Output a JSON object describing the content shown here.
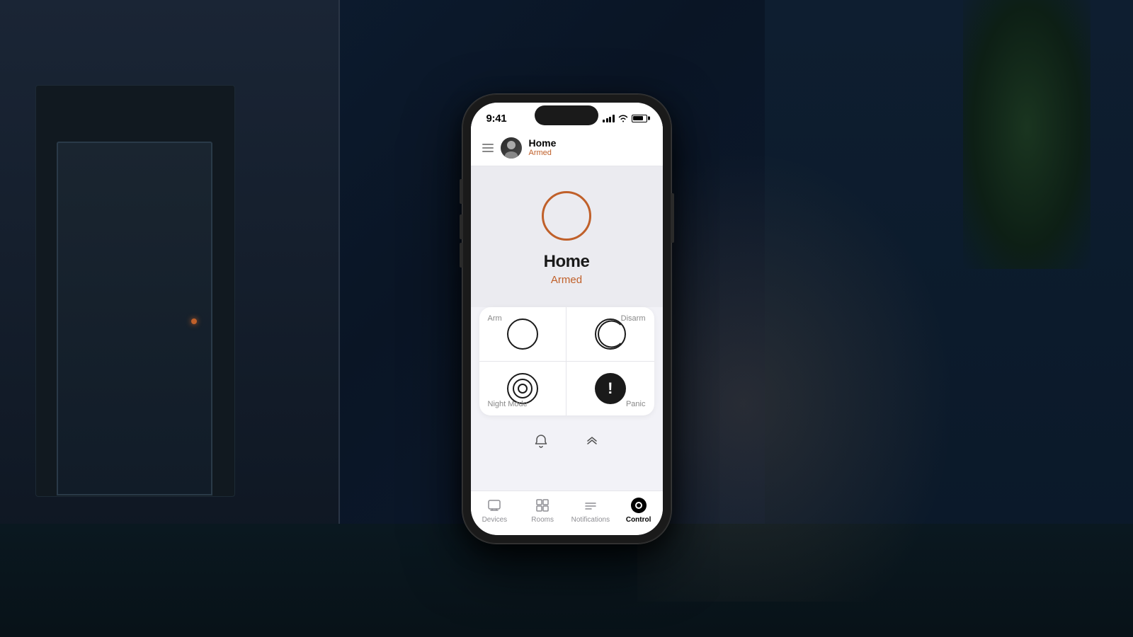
{
  "background": {
    "color": "#0a1628"
  },
  "phone": {
    "status_bar": {
      "time": "9:41",
      "signal_label": "signal",
      "wifi_label": "wifi",
      "battery_label": "battery"
    },
    "nav": {
      "menu_label": "Menu",
      "home_name": "Home",
      "home_status": "Armed"
    },
    "hero": {
      "title": "Home",
      "status": "Armed",
      "circle_label": "armed indicator"
    },
    "controls": {
      "arm_label": "Arm",
      "disarm_label": "Disarm",
      "night_mode_label": "Night Mode",
      "panic_label": "Panic"
    },
    "quick_actions": {
      "bell_label": "Notifications",
      "chevron_label": "Scroll Up"
    },
    "tabs": [
      {
        "id": "devices",
        "label": "Devices",
        "active": false
      },
      {
        "id": "rooms",
        "label": "Rooms",
        "active": false
      },
      {
        "id": "notifications",
        "label": "Notifications",
        "active": false
      },
      {
        "id": "control",
        "label": "Control",
        "active": true
      }
    ]
  }
}
